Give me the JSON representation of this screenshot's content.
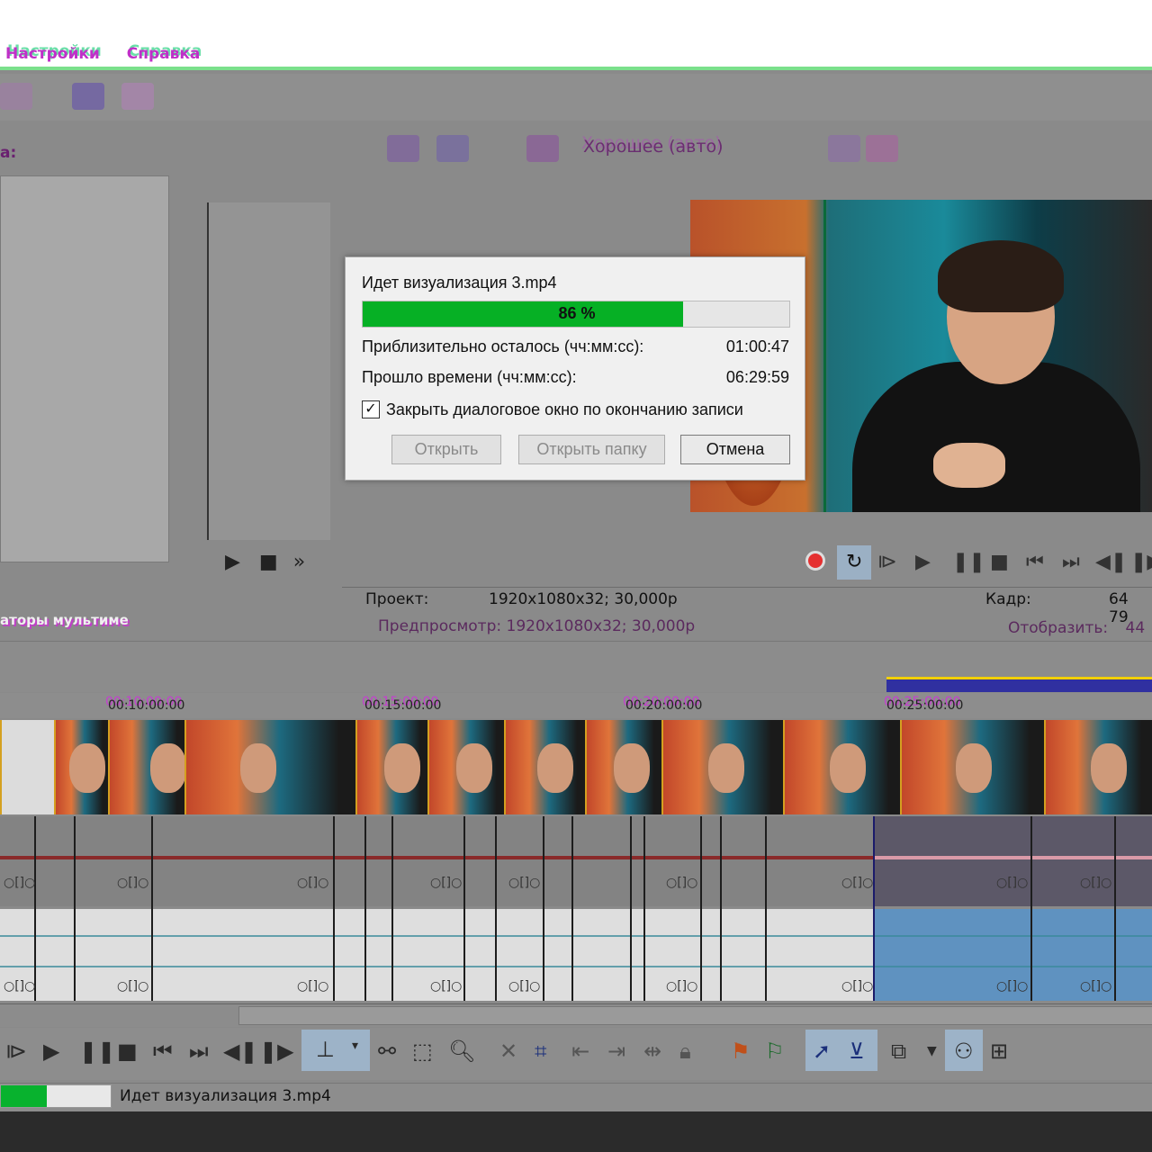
{
  "menu": {
    "settings": "Настройки",
    "help": "Справка"
  },
  "explorer": {
    "label": "a:"
  },
  "left_tab": {
    "label": "аторы мультиме"
  },
  "preview_toolbar": {
    "quality": "Хорошее (авто)"
  },
  "info": {
    "project_label": "Проект:",
    "project_value": "1920x1080x32; 30,000p",
    "preview_label": "Предпросмотр:",
    "preview_value": "1920x1080x32; 30,000p",
    "frame_label": "Кадр:",
    "frame_value": "64 79",
    "display_label": "Отобразить:",
    "display_value": "44"
  },
  "dialog": {
    "title": "Идет визуализация 3.mp4",
    "progress_percent": 86,
    "progress_text": "86 %",
    "remaining_label": "Приблизительно осталось (чч:мм:сс):",
    "remaining_value": "01:00:47",
    "elapsed_label": "Прошло времени (чч:мм:сс):",
    "elapsed_value": "06:29:59",
    "close_checkbox_label": "Закрыть диалоговое окно по окончанию записи",
    "close_checked": true,
    "open_button": "Открыть",
    "open_folder_button": "Открыть папку",
    "cancel_button": "Отмена"
  },
  "timeline": {
    "ticks": [
      "00:10:00:00",
      "00:15:00:00",
      "00:20:00:00",
      "00:25:00:00"
    ]
  },
  "status": {
    "text": "Идет визуализация 3.mp4",
    "progress_fraction": 0.42
  },
  "colors": {
    "progress_green": "#06b025",
    "accent_blue": "#5f92c0"
  }
}
